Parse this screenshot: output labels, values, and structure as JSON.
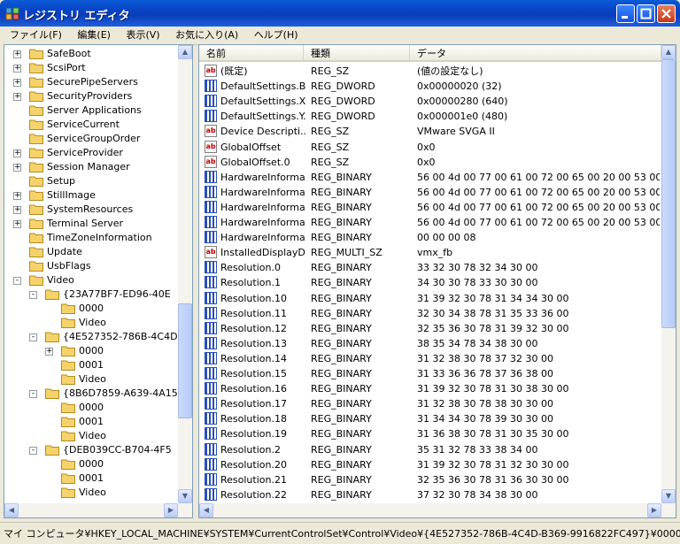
{
  "window": {
    "title": "レジストリ エディタ"
  },
  "menu": [
    "ファイル(F)",
    "編集(E)",
    "表示(V)",
    "お気に入り(A)",
    "ヘルプ(H)"
  ],
  "tree": [
    {
      "label": "SafeBoot",
      "level": 0,
      "exp": "+"
    },
    {
      "label": "ScsiPort",
      "level": 0,
      "exp": "+"
    },
    {
      "label": "SecurePipeServers",
      "level": 0,
      "exp": "+"
    },
    {
      "label": "SecurityProviders",
      "level": 0,
      "exp": "+"
    },
    {
      "label": "Server Applications",
      "level": 0,
      "exp": ""
    },
    {
      "label": "ServiceCurrent",
      "level": 0,
      "exp": ""
    },
    {
      "label": "ServiceGroupOrder",
      "level": 0,
      "exp": ""
    },
    {
      "label": "ServiceProvider",
      "level": 0,
      "exp": "+"
    },
    {
      "label": "Session Manager",
      "level": 0,
      "exp": "+"
    },
    {
      "label": "Setup",
      "level": 0,
      "exp": ""
    },
    {
      "label": "StillImage",
      "level": 0,
      "exp": "+"
    },
    {
      "label": "SystemResources",
      "level": 0,
      "exp": "+"
    },
    {
      "label": "Terminal Server",
      "level": 0,
      "exp": "+"
    },
    {
      "label": "TimeZoneInformation",
      "level": 0,
      "exp": ""
    },
    {
      "label": "Update",
      "level": 0,
      "exp": ""
    },
    {
      "label": "UsbFlags",
      "level": 0,
      "exp": ""
    },
    {
      "label": "Video",
      "level": 0,
      "exp": "-"
    },
    {
      "label": "{23A77BF7-ED96-40E",
      "level": 1,
      "exp": "-"
    },
    {
      "label": "0000",
      "level": 2,
      "exp": ""
    },
    {
      "label": "Video",
      "level": 2,
      "exp": ""
    },
    {
      "label": "{4E527352-786B-4C4D",
      "level": 1,
      "exp": "-"
    },
    {
      "label": "0000",
      "level": 2,
      "exp": "+",
      "selected": true
    },
    {
      "label": "0001",
      "level": 2,
      "exp": ""
    },
    {
      "label": "Video",
      "level": 2,
      "exp": ""
    },
    {
      "label": "{8B6D7859-A639-4A15",
      "level": 1,
      "exp": "-"
    },
    {
      "label": "0000",
      "level": 2,
      "exp": ""
    },
    {
      "label": "0001",
      "level": 2,
      "exp": ""
    },
    {
      "label": "Video",
      "level": 2,
      "exp": ""
    },
    {
      "label": "{DEB039CC-B704-4F5",
      "level": 1,
      "exp": "-"
    },
    {
      "label": "0000",
      "level": 2,
      "exp": ""
    },
    {
      "label": "0001",
      "level": 2,
      "exp": ""
    },
    {
      "label": "Video",
      "level": 2,
      "exp": ""
    }
  ],
  "list": {
    "columns": [
      "名前",
      "種類",
      "データ"
    ],
    "rows": [
      {
        "name": "(既定)",
        "type": "REG_SZ",
        "data": "(値の設定なし)",
        "icon": "sz"
      },
      {
        "name": "DefaultSettings.B...",
        "type": "REG_DWORD",
        "data": "0x00000020 (32)",
        "icon": "bin"
      },
      {
        "name": "DefaultSettings.X...",
        "type": "REG_DWORD",
        "data": "0x00000280 (640)",
        "icon": "bin"
      },
      {
        "name": "DefaultSettings.Y...",
        "type": "REG_DWORD",
        "data": "0x000001e0 (480)",
        "icon": "bin"
      },
      {
        "name": "Device Descripti...",
        "type": "REG_SZ",
        "data": "VMware SVGA II",
        "icon": "sz"
      },
      {
        "name": "GlobalOffset",
        "type": "REG_SZ",
        "data": "0x0",
        "icon": "sz"
      },
      {
        "name": "GlobalOffset.0",
        "type": "REG_SZ",
        "data": "0x0",
        "icon": "sz"
      },
      {
        "name": "HardwareInformat...",
        "type": "REG_BINARY",
        "data": "56 00 4d 00 77 00 61 00 72 00 65 00 20 00 53 00 56...",
        "icon": "bin"
      },
      {
        "name": "HardwareInformat...",
        "type": "REG_BINARY",
        "data": "56 00 4d 00 77 00 61 00 72 00 65 00 20 00 53 00 56...",
        "icon": "bin"
      },
      {
        "name": "HardwareInformat...",
        "type": "REG_BINARY",
        "data": "56 00 4d 00 77 00 61 00 72 00 65 00 20 00 53 00 56...",
        "icon": "bin"
      },
      {
        "name": "HardwareInformat...",
        "type": "REG_BINARY",
        "data": "56 00 4d 00 77 00 61 00 72 00 65 00 20 00 53 00 56...",
        "icon": "bin"
      },
      {
        "name": "HardwareInformat...",
        "type": "REG_BINARY",
        "data": "00 00 00 08",
        "icon": "bin"
      },
      {
        "name": "InstalledDisplayD...",
        "type": "REG_MULTI_SZ",
        "data": "vmx_fb",
        "icon": "sz"
      },
      {
        "name": "Resolution.0",
        "type": "REG_BINARY",
        "data": "33 32 30 78 32 34 30 00",
        "icon": "bin"
      },
      {
        "name": "Resolution.1",
        "type": "REG_BINARY",
        "data": "34 30 30 78 33 30 30 00",
        "icon": "bin"
      },
      {
        "name": "Resolution.10",
        "type": "REG_BINARY",
        "data": "31 39 32 30 78 31 34 34 30 00",
        "icon": "bin"
      },
      {
        "name": "Resolution.11",
        "type": "REG_BINARY",
        "data": "32 30 34 38 78 31 35 33 36 00",
        "icon": "bin"
      },
      {
        "name": "Resolution.12",
        "type": "REG_BINARY",
        "data": "32 35 36 30 78 31 39 32 30 00",
        "icon": "bin"
      },
      {
        "name": "Resolution.13",
        "type": "REG_BINARY",
        "data": "38 35 34 78 34 38 30 00",
        "icon": "bin"
      },
      {
        "name": "Resolution.14",
        "type": "REG_BINARY",
        "data": "31 32 38 30 78 37 32 30 00",
        "icon": "bin"
      },
      {
        "name": "Resolution.15",
        "type": "REG_BINARY",
        "data": "31 33 36 36 78 37 36 38 00",
        "icon": "bin"
      },
      {
        "name": "Resolution.16",
        "type": "REG_BINARY",
        "data": "31 39 32 30 78 31 30 38 30 00",
        "icon": "bin"
      },
      {
        "name": "Resolution.17",
        "type": "REG_BINARY",
        "data": "31 32 38 30 78 38 30 30 00",
        "icon": "bin"
      },
      {
        "name": "Resolution.18",
        "type": "REG_BINARY",
        "data": "31 34 34 30 78 39 30 30 00",
        "icon": "bin"
      },
      {
        "name": "Resolution.19",
        "type": "REG_BINARY",
        "data": "31 36 38 30 78 31 30 35 30 00",
        "icon": "bin"
      },
      {
        "name": "Resolution.2",
        "type": "REG_BINARY",
        "data": "35 31 32 78 33 38 34 00",
        "icon": "bin"
      },
      {
        "name": "Resolution.20",
        "type": "REG_BINARY",
        "data": "31 39 32 30 78 31 32 30 30 00",
        "icon": "bin"
      },
      {
        "name": "Resolution.21",
        "type": "REG_BINARY",
        "data": "32 35 36 30 78 31 36 30 30 00",
        "icon": "bin"
      },
      {
        "name": "Resolution.22",
        "type": "REG_BINARY",
        "data": "37 32 30 78 34 38 30 00",
        "icon": "bin"
      }
    ]
  },
  "statusbar": {
    "path": "マイ コンピュータ¥HKEY_LOCAL_MACHINE¥SYSTEM¥CurrentControlSet¥Control¥Video¥{4E527352-786B-4C4D-B369-9916822FC497}¥0000"
  },
  "icons": {
    "minimize": "minimize-icon",
    "maximize": "maximize-icon",
    "close": "close-icon",
    "folder": "folder-icon",
    "reg_sz": "reg-sz-icon",
    "reg_binary": "reg-binary-icon"
  },
  "colors": {
    "titlebar": "#0a4fd0",
    "folder": "#f5d36a",
    "sz_icon": "#c00000",
    "bin_icon": "#2a4fb8"
  }
}
